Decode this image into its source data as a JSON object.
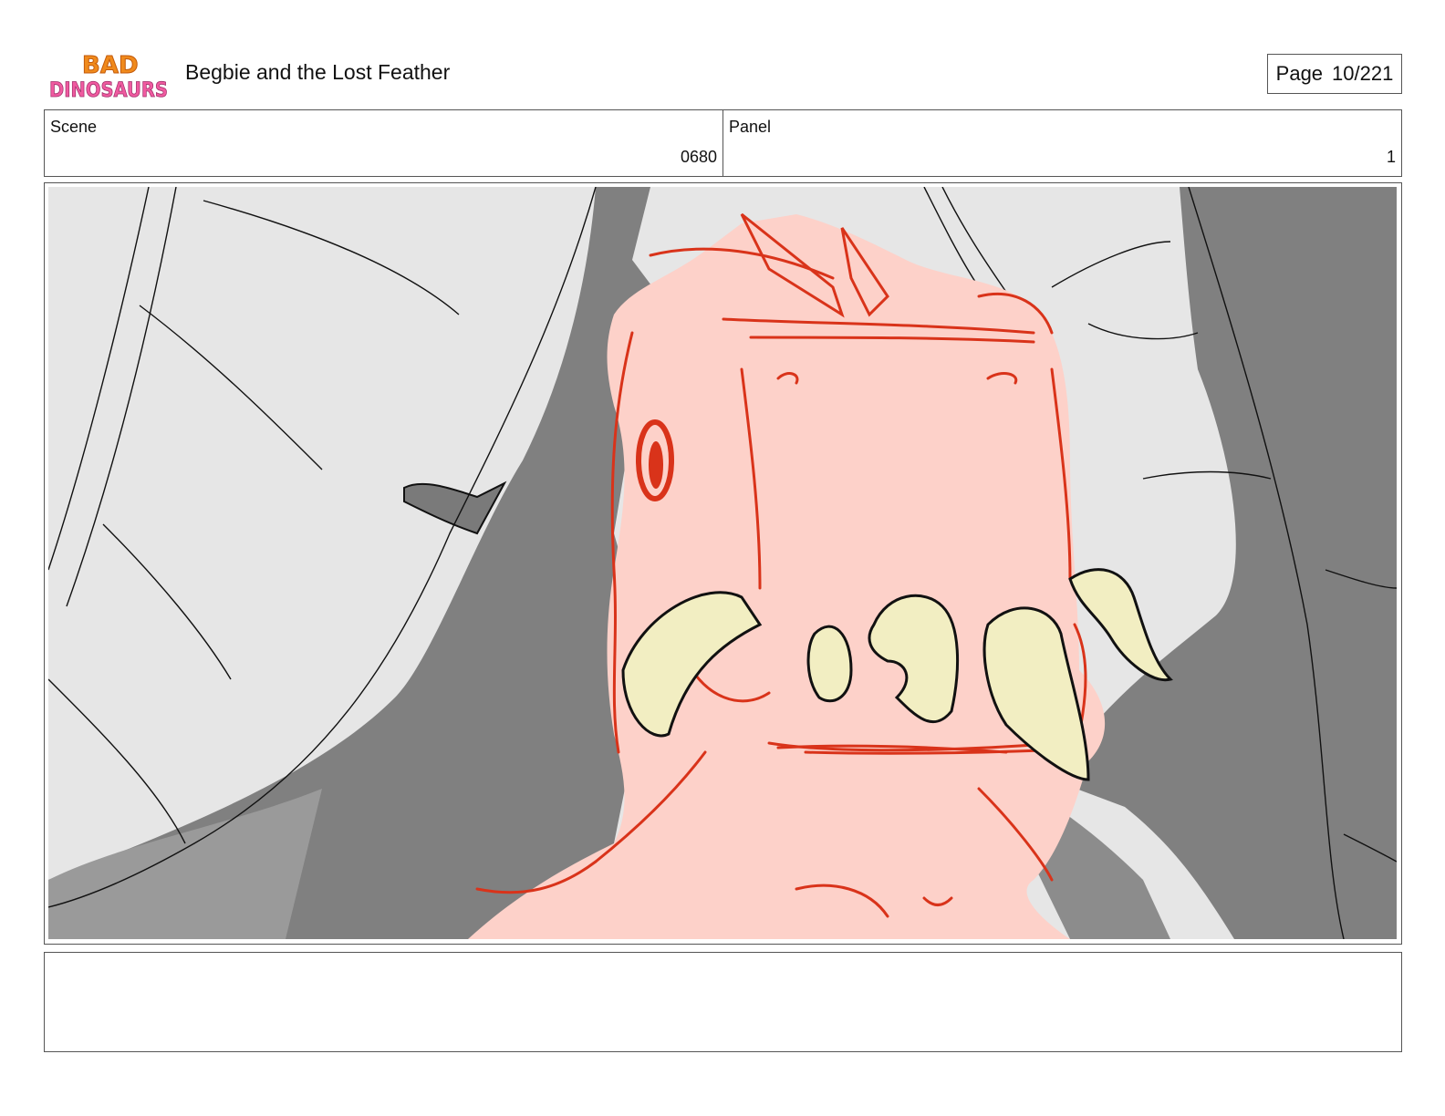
{
  "header": {
    "logo_line1": "BAD",
    "logo_line2": "DINOSAURS",
    "title": "Begbie and the Lost Feather",
    "page_label": "Page",
    "page_value": "10/221"
  },
  "info": {
    "scene_label": "Scene",
    "scene_value": "0680",
    "panel_label": "Panel",
    "panel_value": "1"
  },
  "panel": {
    "description": "",
    "colors": {
      "background_light": "#e6e6e6",
      "shadow_dark": "#808080",
      "shadow_mid": "#9a9a9a",
      "dino_skin": "#fdd1c9",
      "dino_line": "#d9331a",
      "teeth_fill": "#f2eec2",
      "ink": "#111111"
    }
  },
  "notes": {
    "text": ""
  }
}
